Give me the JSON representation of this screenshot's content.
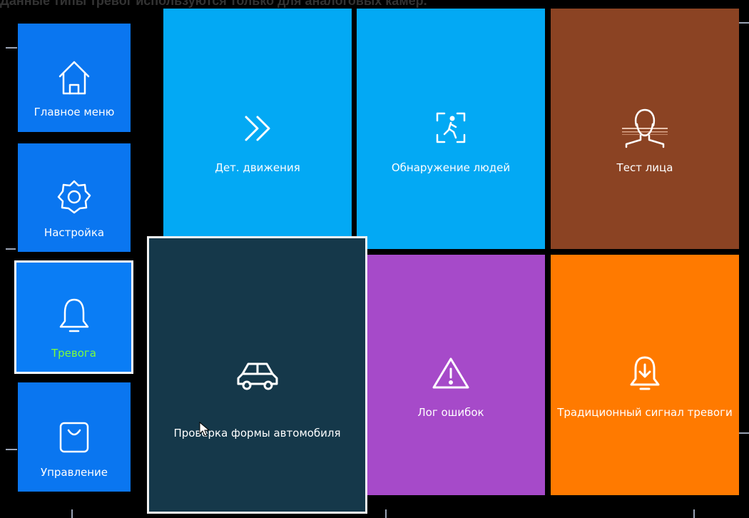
{
  "caption": "Данные типы тревог используются только для аналоговых камер.",
  "colors": {
    "background": "#000000",
    "nav_tile": "#0a76f0",
    "active_label": "#7cff3b",
    "tile_blue": "#03a9f4",
    "tile_brown": "#8b4323",
    "tile_dark": "#15384a",
    "tile_purple": "#a64ac9",
    "tile_orange": "#ff7a00"
  },
  "sidebar": {
    "items": [
      {
        "label": "Главное меню",
        "icon": "home-icon"
      },
      {
        "label": "Настройка",
        "icon": "gear-icon"
      },
      {
        "label": "Тревога",
        "icon": "bell-icon",
        "active": true
      },
      {
        "label": "Управление",
        "icon": "bag-icon"
      }
    ]
  },
  "tiles": [
    {
      "label": "Дет. движения",
      "icon": "chevrons-right-icon"
    },
    {
      "label": "Обнаружение людей",
      "icon": "person-detect-icon"
    },
    {
      "label": "Тест лица",
      "icon": "face-icon"
    },
    {
      "label": "Проверка формы автомобиля",
      "icon": "car-icon",
      "selected": true
    },
    {
      "label": "Лог ошибок",
      "icon": "warning-icon"
    },
    {
      "label": "Традиционный сигнал тревоги",
      "icon": "alarm-bell-icon"
    }
  ]
}
